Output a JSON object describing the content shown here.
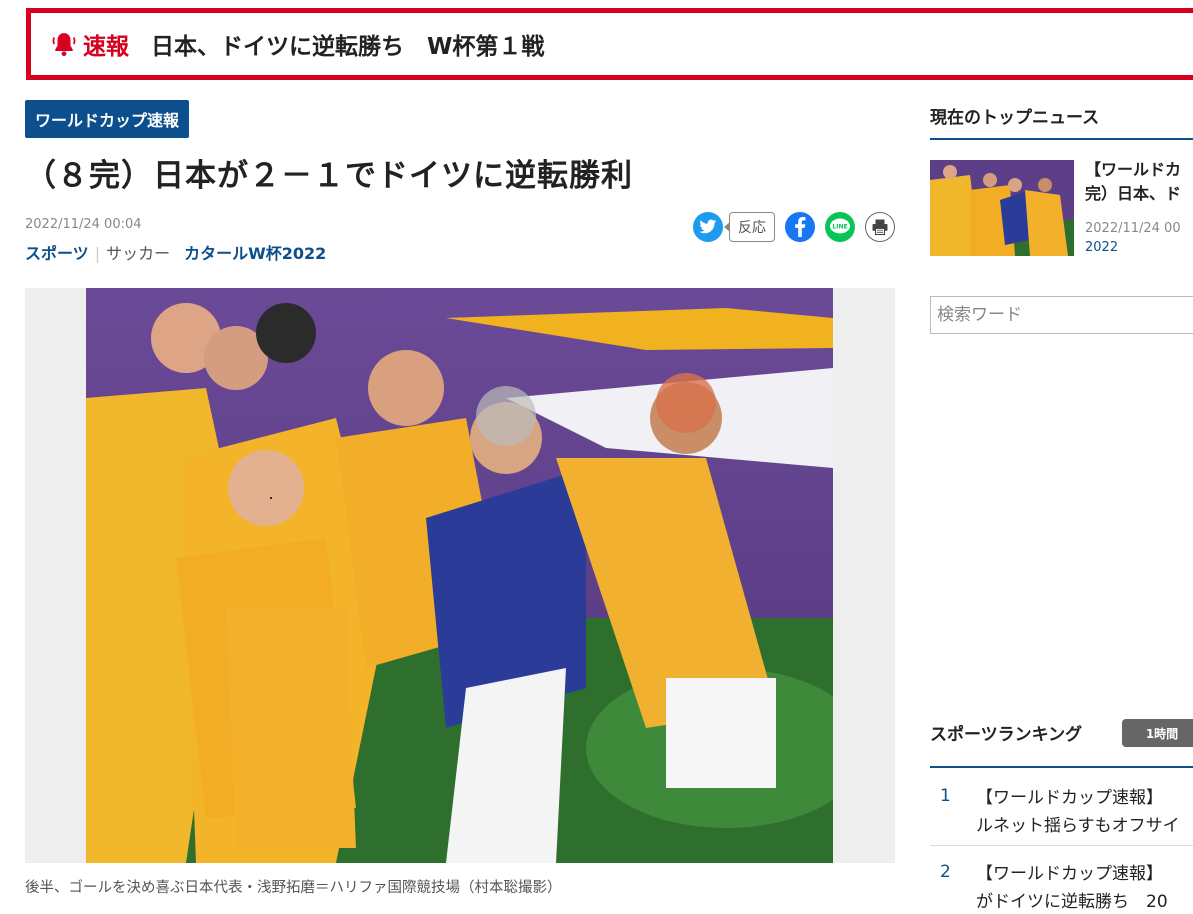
{
  "breaking": {
    "label": "速報",
    "text": "日本、ドイツに逆転勝ち　W杯第１戦",
    "icon": "bell-icon"
  },
  "article": {
    "tag": "ワールドカップ速報",
    "headline": "（８完）日本が２－１でドイツに逆転勝利",
    "date": "2022/11/24 00:04",
    "categories": {
      "primary": "スポーツ",
      "secondary": "サッカー",
      "topic": "カタールW杯2022"
    },
    "reaction_label": "反応",
    "caption": "後半、ゴールを決め喜ぶ日本代表・浅野拓磨＝ハリファ国際競技場（村本聡撮影）"
  },
  "sidebar": {
    "top_news_title": "現在のトップニュース",
    "top_item": {
      "title_line1": "【ワールドカ",
      "title_line2": "完）日本、ド",
      "date": "2022/11/24 00",
      "date_cont": "2022"
    },
    "search_placeholder": "検索ワード",
    "ranking_title": "スポーツランキング",
    "ranking_tab": "1時間",
    "ranking": [
      {
        "num": "1",
        "line1": "【ワールドカップ速報】",
        "line2": "ルネット揺らすもオフサイ"
      },
      {
        "num": "2",
        "line1": "【ワールドカップ速報】",
        "line2": "がドイツに逆転勝ち　20"
      }
    ]
  },
  "colors": {
    "accent_red": "#d7001e",
    "brand_blue": "#0c4f8c"
  }
}
